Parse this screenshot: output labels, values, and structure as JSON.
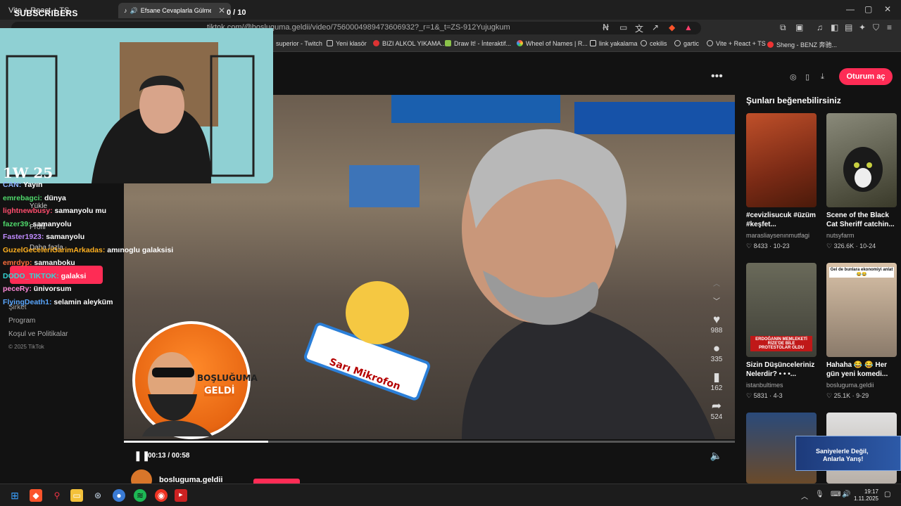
{
  "browser": {
    "tabs": [
      {
        "label": "Vite + React + TS",
        "active": false
      },
      {
        "label": "Efsane Cevaplarla Gülmek Ga",
        "active": true
      }
    ],
    "url": "tiktok.com/@bosluguma.geldii/video/7560004989473606932?_r=1&_t=ZS-912Yujugkum",
    "bookmarks": [
      "superior - Twitch",
      "Yeni klasör",
      "BIZI ALKOL YIKAMA...",
      "Draw It! - İnteraktif...",
      "Wheel of Names | R...",
      "link yakalama",
      "cekilis",
      "gartic",
      "Vite + React + TS",
      "Sheng - BENZ 奔驰..."
    ]
  },
  "stream_overlay": {
    "subscribers_label": "SUBSCRIBERS",
    "subscribers_count": "0 / 10",
    "wl_score": "1W 25",
    "chat": [
      {
        "user": "CAN",
        "message": "Yayın",
        "user_color": "#8fb5ff"
      },
      {
        "user": "emrebagci",
        "message": "dünya",
        "user_color": "#4fd96b"
      },
      {
        "user": "lightnewbusy",
        "message": "samanyolu mu",
        "user_color": "#ff4d6d"
      },
      {
        "user": "fazer39",
        "message": "samanyolu",
        "user_color": "#4fd96b"
      },
      {
        "user": "Faster1923",
        "message": "samanyolu",
        "user_color": "#c08bff"
      },
      {
        "user": "GuzelGeceleriGarimArkadas",
        "message": "amınoglu galaksisi",
        "user_color": "#ffb020"
      },
      {
        "user": "emrdyp",
        "message": "samanboku",
        "user_color": "#ff6f3c"
      },
      {
        "user": "DODO_TIKTOK",
        "message": "galaksi",
        "user_color": "#33d6d6"
      },
      {
        "user": "peceRy",
        "message": "ünivorsum",
        "user_color": "#ff8ad8"
      },
      {
        "user": "FlyingDeath1",
        "message": "selamin aleyküm",
        "user_color": "#5aa7ff"
      }
    ]
  },
  "sidebar": {
    "hidden_items": [
      "Yükle",
      "Profil",
      "Daha fazla"
    ],
    "links": [
      "Şirket",
      "Program",
      "Koşul ve Politikalar"
    ],
    "copyright": "© 2025 TikTok"
  },
  "video": {
    "logo_line1": "BOŞLUĞUMA",
    "logo_line2": "GELDİ",
    "mic_text": "Sarı Mikrofon",
    "likes": "988",
    "comments": "335",
    "saves": "162",
    "shares": "524",
    "time": "00:13 / 00:58",
    "progress": 0.236,
    "author": "bosluguma.geldii"
  },
  "right": {
    "login_label": "Oturum aç",
    "rec_title": "Şunları beğenebilirsiniz",
    "cards": [
      {
        "title": "#cevizlisucuk #üzüm #keşfet...",
        "user": "marasliaysenınmutfagi",
        "likes": "8433",
        "date": "10-23",
        "thumb": "#7a2a15"
      },
      {
        "title": "Scene of the Black Cat Sheriff catchin...",
        "user": "nutsyfarm",
        "likes": "326.6K",
        "date": "10-24",
        "thumb": "#5a5a4a"
      },
      {
        "title": "Sizin Düşünceleriniz Nelerdir? • • •...",
        "user": "istanbultimes",
        "likes": "5831",
        "date": "4-3",
        "thumb": "#444a40",
        "overlay": "ERDOĞANIN MEMLEKETİ RİZE'DE BİLE PROTESTOLAR OLDU"
      },
      {
        "title": "Hahaha 😂 😂 Her gün yeni komedi...",
        "user": "bosluguma.geldii",
        "likes": "25.1K",
        "date": "9-29",
        "thumb": "#8a7a6a",
        "overlay": "Gel de bunlara ekonomiyi anlat 😂😂"
      }
    ],
    "ad": {
      "line1": "Saniyelerle Değil,",
      "line2": "Anlarla Yarış!"
    }
  },
  "taskbar": {
    "time": "19:17",
    "date": "1.11.2025"
  },
  "colors": {
    "tiktok_red": "#fe2c55",
    "bg": "#121212"
  }
}
